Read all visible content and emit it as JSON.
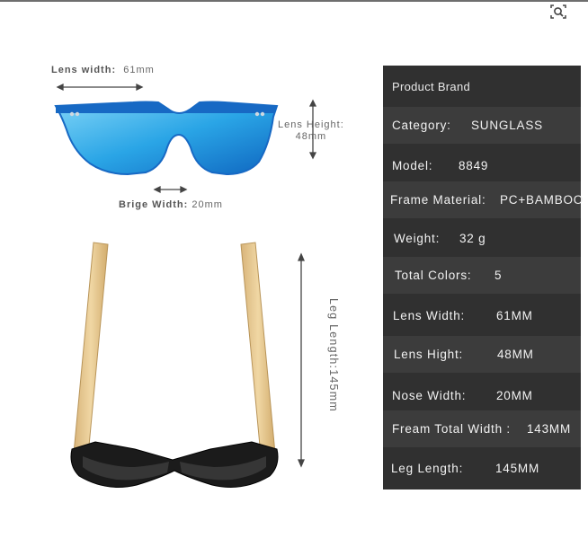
{
  "dimension_labels": {
    "lens_width_label": "Lens width:",
    "lens_width_value": "61mm",
    "lens_height_label": "Lens Height:",
    "lens_height_value": "48mm",
    "bridge_width_label": "Brige Width:",
    "bridge_width_value": "20mm",
    "leg_length": "Leg Length:145mm"
  },
  "spec_table": {
    "header": "Product Brand",
    "rows": [
      {
        "key": "Category:",
        "value": "SUNGLASS"
      },
      {
        "key": "Model:",
        "value": "8849"
      },
      {
        "key": "Frame Material:",
        "value": "PC+BAMBOO"
      },
      {
        "key": "Weight:",
        "value": "32 g"
      },
      {
        "key": "Total Colors:",
        "value": "5"
      },
      {
        "key": "Lens Width:",
        "value": "61MM"
      },
      {
        "key": "Lens Hight:",
        "value": "48MM"
      },
      {
        "key": "Nose Width:",
        "value": "20MM"
      },
      {
        "key": "Fream Total Width :",
        "value": "143MM"
      },
      {
        "key": "Leg Length:",
        "value": "145MM"
      }
    ]
  },
  "icons": {
    "visual_search": "lens-search-icon"
  },
  "colors": {
    "lens_blue": "#1f8fd8",
    "frame_blue": "#1769c4",
    "bamboo": "#e3c48a",
    "table_bg": "#303030"
  }
}
